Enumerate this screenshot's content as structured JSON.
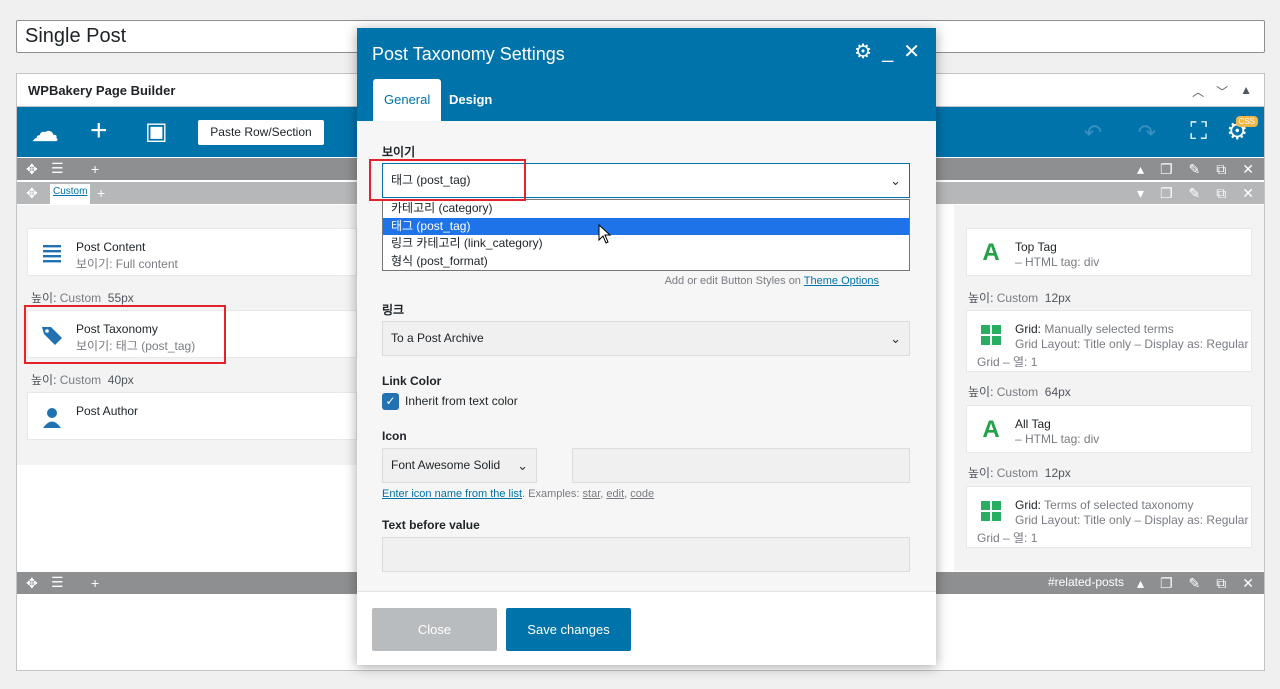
{
  "post_title": "Single Post",
  "builder": {
    "title": "WPBakery Page Builder",
    "paste_label": "Paste Row/Section",
    "css_badge": "CSS",
    "custom_tab": "Custom",
    "row_tag": "#related-posts"
  },
  "left_column": {
    "elements": [
      {
        "title": "Post Content",
        "subtitle": "보이기: Full content",
        "icon": "lines-icon"
      },
      {
        "title": "Post Taxonomy",
        "subtitle": "보이기: 태그 (post_tag)",
        "icon": "tag-icon"
      },
      {
        "title": "Post Author",
        "subtitle": "",
        "icon": "user-icon"
      }
    ],
    "spacers": [
      {
        "label": "높이:",
        "custom": "Custom",
        "value": "55px"
      },
      {
        "label": "높이:",
        "custom": "Custom",
        "value": "40px"
      }
    ]
  },
  "right_column": {
    "elements": [
      {
        "title": "Top Tag",
        "subtitle": "– HTML tag: div",
        "icon": "text-a-icon"
      },
      {
        "title": "Grid:",
        "desc": "Manually selected terms",
        "subtitle": "Grid Layout: Title only – Display as: Regular",
        "subtitle2": "Grid – 열: 1",
        "icon": "grid-icon"
      },
      {
        "title": "All Tag",
        "subtitle": "– HTML tag: div",
        "icon": "text-a-icon"
      },
      {
        "title": "Grid:",
        "desc": "Terms of selected taxonomy",
        "subtitle": "Grid Layout: Title only – Display as: Regular",
        "subtitle2": "Grid – 열: 1",
        "icon": "grid-icon"
      }
    ],
    "spacers": [
      {
        "label": "높이:",
        "custom": "Custom",
        "value": "12px"
      },
      {
        "label": "높이:",
        "custom": "Custom",
        "value": "64px"
      },
      {
        "label": "높이:",
        "custom": "Custom",
        "value": "12px"
      }
    ]
  },
  "modal": {
    "title": "Post Taxonomy Settings",
    "tabs": [
      "General",
      "Design"
    ],
    "show_label": "보이기",
    "show_value": "태그 (post_tag)",
    "show_options": [
      "카테고리 (category)",
      "태그 (post_tag)",
      "링크 카테고리 (link_category)",
      "형식 (post_format)"
    ],
    "button_hint_prefix": "Add or edit Button Styles on",
    "button_hint_link": "Theme Options",
    "link_label": "링크",
    "link_value": "To a Post Archive",
    "link_color_label": "Link Color",
    "inherit_label": "Inherit from text color",
    "icon_label": "Icon",
    "icon_lib_value": "Font Awesome Solid",
    "icon_hint_link": "Enter icon name from the list",
    "icon_hint_examples": ". Examples:",
    "icon_examples": [
      "star",
      "edit",
      "code"
    ],
    "text_before_label": "Text before value",
    "close_label": "Close",
    "save_label": "Save changes"
  }
}
